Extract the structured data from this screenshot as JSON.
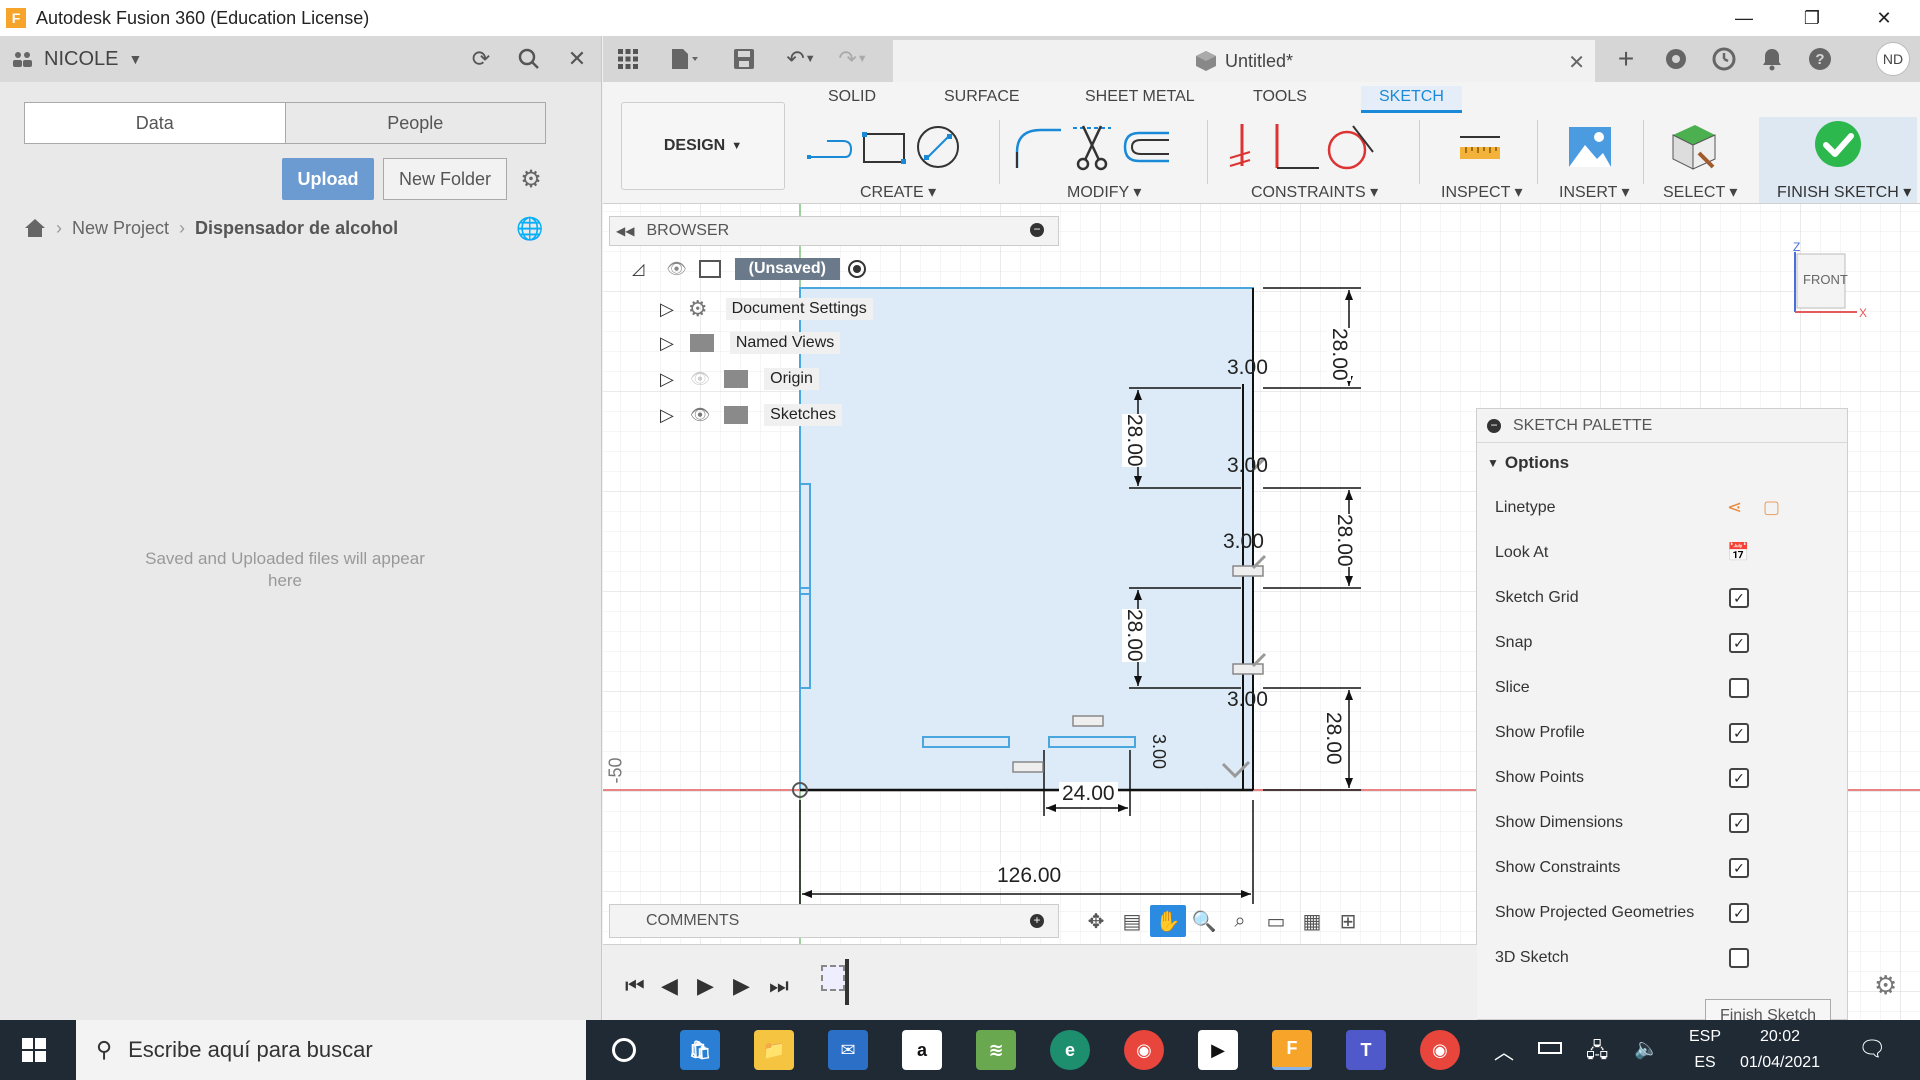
{
  "window": {
    "title": "Autodesk Fusion 360 (Education License)",
    "logo_letter": "F",
    "minimize": "—",
    "restore": "❐",
    "close": "✕"
  },
  "data_panel": {
    "user": "NICOLE",
    "tabs": [
      {
        "label": "Data",
        "active": true
      },
      {
        "label": "People",
        "active": false
      }
    ],
    "upload_label": "Upload",
    "new_folder_label": "New Folder",
    "breadcrumb": {
      "project": "New Project",
      "current": "Dispensador de alcohol"
    },
    "empty_message": "Saved and Uploaded files will appear here"
  },
  "doc_tab": {
    "title": "Untitled*",
    "avatar": "ND"
  },
  "ribbon": {
    "workspace": "DESIGN",
    "tabs": [
      "SOLID",
      "SURFACE",
      "SHEET METAL",
      "TOOLS",
      "SKETCH"
    ],
    "active_tab": "SKETCH",
    "groups": [
      "CREATE",
      "MODIFY",
      "CONSTRAINTS",
      "INSPECT",
      "INSERT",
      "SELECT",
      "FINISH SKETCH"
    ]
  },
  "browser": {
    "title": "BROWSER",
    "root": "(Unsaved)",
    "items": [
      "Document Settings",
      "Named Views",
      "Origin",
      "Sketches"
    ]
  },
  "viewcube": {
    "face": "FRONT",
    "z": "Z",
    "x": "X"
  },
  "sketch": {
    "dims": {
      "width": "126.00",
      "small": "24.00",
      "height_a": "28.00",
      "thk": "3.00",
      "thk_small": "3.00",
      "axis": "-50"
    }
  },
  "palette": {
    "title": "SKETCH PALETTE",
    "section": "Options",
    "rows": [
      {
        "label": "Linetype",
        "kind": "icons"
      },
      {
        "label": "Look At",
        "kind": "icon"
      },
      {
        "label": "Sketch Grid",
        "kind": "check",
        "checked": true
      },
      {
        "label": "Snap",
        "kind": "check",
        "checked": true
      },
      {
        "label": "Slice",
        "kind": "check",
        "checked": false
      },
      {
        "label": "Show Profile",
        "kind": "check",
        "checked": true
      },
      {
        "label": "Show Points",
        "kind": "check",
        "checked": true
      },
      {
        "label": "Show Dimensions",
        "kind": "check",
        "checked": true
      },
      {
        "label": "Show Constraints",
        "kind": "check",
        "checked": true
      },
      {
        "label": "Show Projected Geometries",
        "kind": "check",
        "checked": true
      },
      {
        "label": "3D Sketch",
        "kind": "check",
        "checked": false
      }
    ],
    "finish_label": "Finish Sketch"
  },
  "comments": {
    "title": "COMMENTS"
  },
  "taskbar": {
    "search_placeholder": "Escribe aquí para buscar",
    "lang_top": "ESP",
    "lang_bottom": "ES",
    "time": "20:02",
    "date": "01/04/2021"
  },
  "colors": {
    "accent": "#1a8ad8",
    "upload": "#6b9bd1",
    "profile": "#dcebf7"
  }
}
